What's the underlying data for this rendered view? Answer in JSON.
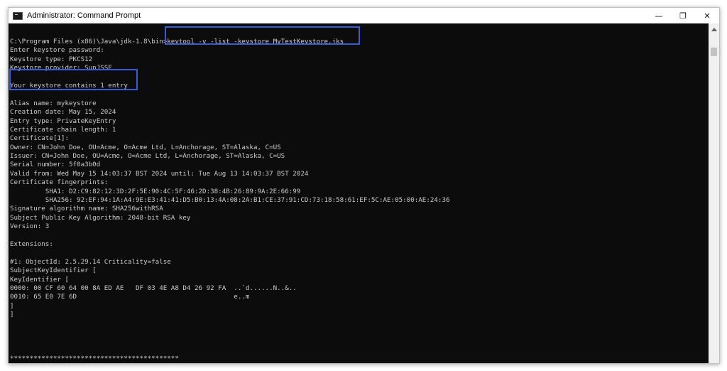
{
  "window": {
    "title": "Administrator: Command Prompt",
    "controls": {
      "minimize": "—",
      "maximize": "❐",
      "close": "✕"
    }
  },
  "terminal": {
    "lines": [
      "C:\\Program Files (x86)\\Java\\jdk-1.8\\bin>keytool -v -list -keystore MyTestKeystore.jks",
      "Enter keystore password:",
      "Keystore type: PKCS12",
      "Keystore provider: SunJSSE",
      "",
      "Your keystore contains 1 entry",
      "",
      "Alias name: mykeystore",
      "Creation date: May 15, 2024",
      "Entry type: PrivateKeyEntry",
      "Certificate chain length: 1",
      "Certificate[1]:",
      "Owner: CN=John Doe, OU=Acme, O=Acme Ltd, L=Anchorage, ST=Alaska, C=US",
      "Issuer: CN=John Doe, OU=Acme, O=Acme Ltd, L=Anchorage, ST=Alaska, C=US",
      "Serial number: 5f0a3b0d",
      "Valid from: Wed May 15 14:03:37 BST 2024 until: Tue Aug 13 14:03:37 BST 2024",
      "Certificate fingerprints:",
      "         SHA1: D2:C9:82:12:3D:2F:5E:90:4C:5F:46:2D:38:4B:26:89:9A:2E:66:99",
      "         SHA256: 92:EF:94:1A:A4:9E:E3:41:41:D5:B0:13:4A:08:2A:B1:CE:37:91:CD:73:18:58:61:EF:5C:AE:05:00:AE:24:36",
      "Signature algorithm name: SHA256withRSA",
      "Subject Public Key Algorithm: 2048-bit RSA key",
      "Version: 3",
      "",
      "Extensions:",
      "",
      "#1: ObjectId: 2.5.29.14 Criticality=false",
      "SubjectKeyIdentifier [",
      "KeyIdentifier [",
      "0000: 00 CF 60 64 00 8A ED AE   DF 03 4E A8 D4 26 92 FA  ..`d......N..&..",
      "0010: 65 E0 7E 6D                                        e..m",
      "]",
      "]",
      "",
      "",
      "",
      "",
      "*******************************************",
      "*******************************************"
    ]
  },
  "colors": {
    "terminal_bg": "#0c0c0c",
    "terminal_fg": "#cccccc",
    "highlight": "#3a5bd9"
  }
}
